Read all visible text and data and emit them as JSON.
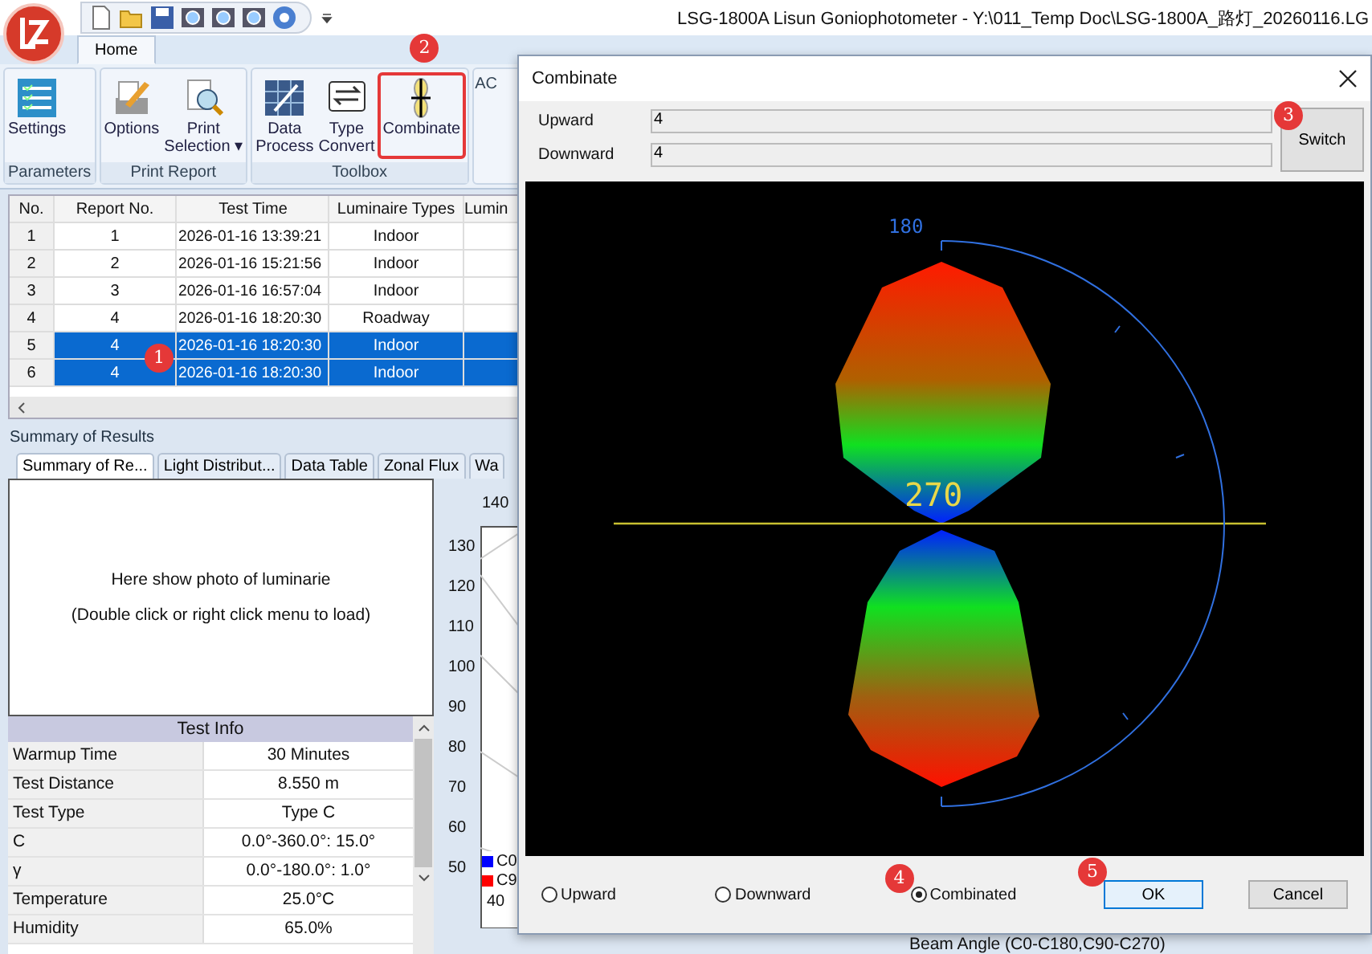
{
  "window": {
    "title": "LSG-1800A Lisun Goniophotometer  - Y:\\011_Temp Doc\\LSG-1800A_路灯_20260116.LG"
  },
  "quick_access": [
    {
      "kind": "new"
    },
    {
      "kind": "open"
    },
    {
      "kind": "save"
    },
    {
      "kind": "tool"
    },
    {
      "kind": "tool"
    },
    {
      "kind": "tool"
    },
    {
      "kind": "help"
    }
  ],
  "ribbon": {
    "tabs": [
      {
        "label": "Home",
        "selected": true
      }
    ],
    "groups": [
      {
        "label": "Parameters",
        "buttons": [
          {
            "label": "Settings",
            "kind": "settings",
            "highlighted": false
          }
        ]
      },
      {
        "label": "Print Report",
        "buttons": [
          {
            "label": "Options",
            "kind": "options",
            "highlighted": false
          },
          {
            "label": "Print\nSelection ▾",
            "kind": "print",
            "highlighted": false
          }
        ]
      },
      {
        "label": "Toolbox",
        "buttons": [
          {
            "label": "Data\nProcess",
            "kind": "data",
            "highlighted": false
          },
          {
            "label": "Type\nConvert",
            "kind": "convert",
            "highlighted": false
          },
          {
            "label": "Combinate",
            "kind": "combinate",
            "highlighted": true,
            "badge": "2"
          }
        ]
      },
      {
        "label": "AC"
      }
    ]
  },
  "table": {
    "columns": [
      "No.",
      "Report No.",
      "Test Time",
      "Luminaire Types",
      "Lumin"
    ],
    "rows": [
      {
        "cells": [
          "1",
          "1",
          "2026-01-16 13:39:21",
          "Indoor"
        ],
        "selected": false
      },
      {
        "cells": [
          "2",
          "2",
          "2026-01-16 15:21:56",
          "Indoor"
        ],
        "selected": false
      },
      {
        "cells": [
          "3",
          "3",
          "2026-01-16 16:57:04",
          "Indoor"
        ],
        "selected": false
      },
      {
        "cells": [
          "4",
          "4",
          "2026-01-16 18:20:30",
          "Roadway"
        ],
        "selected": false
      },
      {
        "cells": [
          "5",
          "4",
          "2026-01-16 18:20:30",
          "Indoor"
        ],
        "selected": true,
        "badge": "1"
      },
      {
        "cells": [
          "6",
          "4",
          "2026-01-16 18:20:30",
          "Indoor"
        ],
        "selected": true
      }
    ]
  },
  "summary": {
    "title": "Summary of Results",
    "tabs": [
      {
        "label": "Summary of Re...",
        "selected": true
      },
      {
        "label": "Light Distribut...",
        "selected": false
      },
      {
        "label": "Data Table",
        "selected": false
      },
      {
        "label": "Zonal Flux",
        "selected": false
      },
      {
        "label": "Wa",
        "selected": false
      }
    ],
    "photo_hint": [
      "Here show photo of luminarie",
      "(Double click or right click menu to load)"
    ],
    "test_info": {
      "title": "Test Info",
      "rows": [
        [
          "Warmup Time",
          "30 Minutes"
        ],
        [
          "Test Distance",
          "8.550 m"
        ],
        [
          "Test Type",
          "Type C"
        ],
        [
          "C",
          "0.0°-360.0°: 15.0°"
        ],
        [
          "γ",
          "0.0°-180.0°: 1.0°"
        ],
        [
          "Temperature",
          "25.0°C"
        ],
        [
          "Humidity",
          "65.0%"
        ]
      ]
    },
    "chart": {
      "top_label": "140",
      "left_labels": [
        "130",
        "120",
        "110",
        "100",
        "90",
        "80",
        "70",
        "60",
        "50"
      ],
      "bottom_label": "40",
      "legend": [
        {
          "label": "C0",
          "color": "#0000ff"
        },
        {
          "label": "C9",
          "color": "#ff0000"
        }
      ]
    },
    "footer_text": "Beam Angle (C0-C180,C90-C270)"
  },
  "dialog": {
    "title": "Combinate",
    "fields": [
      {
        "label": "Upward",
        "value": "4"
      },
      {
        "label": "Downward",
        "value": "4"
      }
    ],
    "switch": {
      "label": "Switch",
      "badge": "3"
    },
    "view": {
      "top_label": "180",
      "center_label": "270"
    },
    "modes": [
      {
        "label": "Upward",
        "selected": false
      },
      {
        "label": "Downward",
        "selected": false
      },
      {
        "label": "Combinated",
        "selected": true,
        "badge": "4"
      }
    ],
    "buttons": [
      {
        "label": "OK",
        "default": true,
        "badge": "5"
      },
      {
        "label": "Cancel",
        "default": false
      }
    ]
  }
}
